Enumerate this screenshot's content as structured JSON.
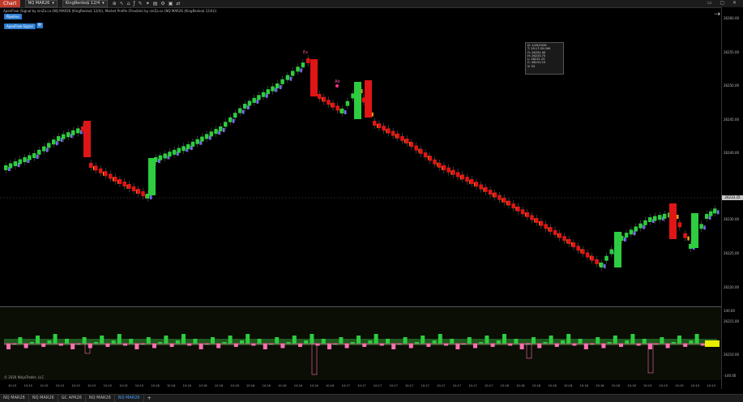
{
  "toolbar": {
    "chart_tab": "Chart",
    "instrument": "NQ MAR26",
    "bar_type": "KingRenko$ 12/4",
    "window_arrow": "⇢"
  },
  "indicator_line": "ApexFlow (Signal by ninZa.co (NQ MAR26 (KingRenko$ 12/4)), Market Profile (Flexible) by ninZa.co (NQ MAR26 (KingRenko$ 12/4)))",
  "buttons": {
    "pipeline": "Pipeline",
    "apexflow_signal": "ApexFlow Signal",
    "gear": "⚙"
  },
  "y_axis": {
    "labels": [
      "26260.00",
      "26255.00",
      "26250.00",
      "26245.00",
      "26240.00",
      "26235.00",
      "26230.00",
      "26225.00",
      "26220.00"
    ],
    "current_price": "26233.25"
  },
  "indicator_axis": {
    "labels": [
      "140.00",
      "26215.00",
      "26210.00",
      "-140.00"
    ]
  },
  "x_axis": {
    "labels": [
      "10:15",
      "10:15",
      "10:15",
      "10:15",
      "10:15",
      "10:15",
      "10:15",
      "10:15",
      "10:15",
      "10:16",
      "10:16",
      "10:16",
      "10:16",
      "10:16",
      "10:16",
      "10:16",
      "10:16",
      "10:16",
      "10:16",
      "10:16",
      "10:16",
      "10:17",
      "10:17",
      "10:17",
      "10:17",
      "10:17",
      "10:17",
      "10:17",
      "10:17",
      "10:17",
      "10:17",
      "10:18",
      "10:18",
      "10:18",
      "10:18",
      "10:18",
      "10:18",
      "10:18",
      "10:18",
      "10:18",
      "10:19",
      "10:19",
      "10:19",
      "10:19",
      "10:19"
    ]
  },
  "data_box": {
    "lines": [
      "D: 1/29/2026",
      "T: 10:17:20.000",
      "O: 26232.00",
      "H: 26233.75",
      "L: 26231.25",
      "C: 26231.25",
      "V: 53"
    ]
  },
  "markers": {
    "ex": "Ex",
    "ab": "Ab"
  },
  "copyright": "© 2026 NinjaTrader, LLC",
  "tabs": [
    "NQ MAR26",
    "NQ MAR26",
    "GC APR26",
    "NQ MAR26",
    "NQ MAR26"
  ],
  "tab_add": "+",
  "colors": {
    "up": "#2ecc40",
    "down": "#e01515",
    "orange": "#f39c12",
    "purple": "#7b6cf6",
    "pink": "#ff6fb3",
    "accent": "#2d7fd3"
  }
}
